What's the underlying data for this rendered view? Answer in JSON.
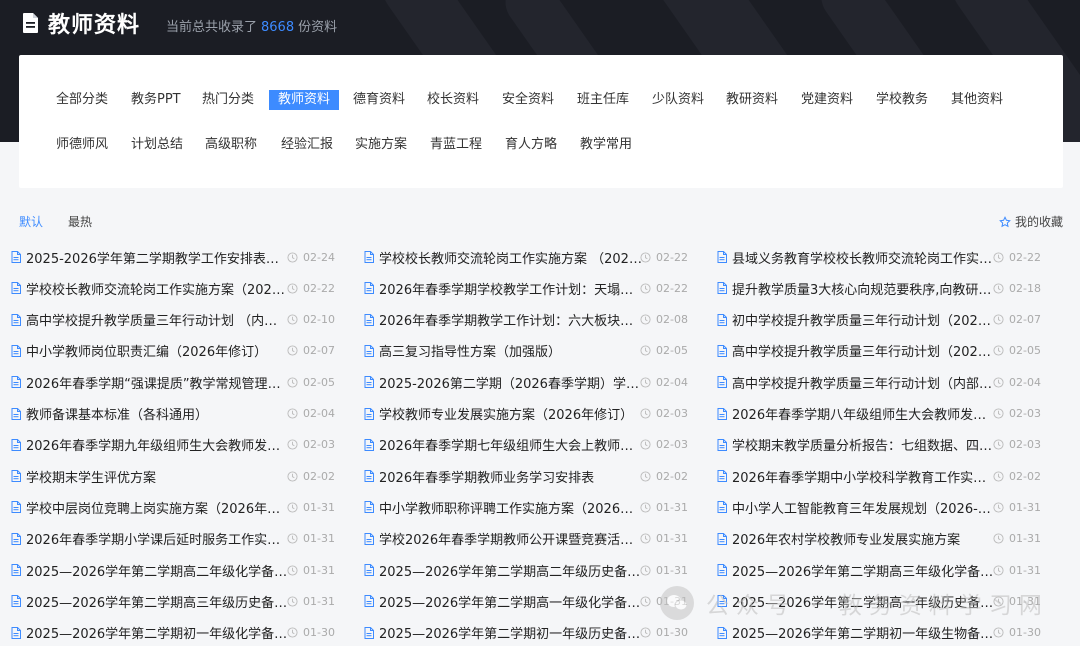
{
  "header": {
    "title": "教师资料",
    "count_prefix": "当前总共收录了",
    "count_value": "8668",
    "count_suffix": "份资料"
  },
  "categories": [
    {
      "label": "全部分类",
      "active": false
    },
    {
      "label": "教务PPT",
      "active": false
    },
    {
      "label": "热门分类",
      "active": false
    },
    {
      "label": "教师资料",
      "active": true
    },
    {
      "label": "德育资料",
      "active": false
    },
    {
      "label": "校长资料",
      "active": false
    },
    {
      "label": "安全资料",
      "active": false
    },
    {
      "label": "班主任库",
      "active": false
    },
    {
      "label": "少队资料",
      "active": false
    },
    {
      "label": "教研资料",
      "active": false
    },
    {
      "label": "党建资料",
      "active": false
    },
    {
      "label": "学校教务",
      "active": false
    },
    {
      "label": "其他资料",
      "active": false
    },
    {
      "label": "师德师风",
      "active": false
    },
    {
      "label": "计划总结",
      "active": false
    },
    {
      "label": "高级职称",
      "active": false
    },
    {
      "label": "经验汇报",
      "active": false
    },
    {
      "label": "实施方案",
      "active": false
    },
    {
      "label": "青蓝工程",
      "active": false
    },
    {
      "label": "育人方略",
      "active": false
    },
    {
      "label": "教学常用",
      "active": false
    }
  ],
  "sort": {
    "default_label": "默认",
    "hot_label": "最热",
    "favorites_label": "我的收藏"
  },
  "items": [
    {
      "title": "2025-2026学年第二学期教学工作安排表：龙…",
      "date": "02-24"
    },
    {
      "title": "学校校长教师交流轮岗工作实施方案 （2026…",
      "date": "02-22"
    },
    {
      "title": "县域义务教育学校校长教师交流轮岗工作实施…",
      "date": "02-22"
    },
    {
      "title": "学校校长教师交流轮岗工作实施方案（2026年…",
      "date": "02-22"
    },
    {
      "title": "2026年春季学期学校教学工作计划：天塌了！5…",
      "date": "02-22"
    },
    {
      "title": "提升教学质量3大核心向规范要秩序,向教研要…",
      "date": "02-18"
    },
    {
      "title": "高中学校提升教学质量三年行动计划 （内部使…",
      "date": "02-10"
    },
    {
      "title": "2026年春季学期教学工作计划：六大板块+落…",
      "date": "02-08"
    },
    {
      "title": "初中学校提升教学质量三年行动计划（2026-2…",
      "date": "02-07"
    },
    {
      "title": "中小学教师岗位职责汇编（2026年修订）",
      "date": "02-07"
    },
    {
      "title": "高三复习指导性方案（加强版）",
      "date": "02-05"
    },
    {
      "title": "高中学校提升教学质量三年行动计划（2026-2…",
      "date": "02-05"
    },
    {
      "title": "2026年春季学期“强课提质”教学常规管理实…",
      "date": "02-05"
    },
    {
      "title": "2025-2026第二学期（2026春季学期）学校教…",
      "date": "02-04"
    },
    {
      "title": "高中学校提升教学质量三年行动计划（内部使…",
      "date": "02-04"
    },
    {
      "title": "教师备课基本标准（各科通用）",
      "date": "02-04"
    },
    {
      "title": "学校教师专业发展实施方案（2026年修订）",
      "date": "02-03"
    },
    {
      "title": "2026年春季学期八年级组师生大会教师发言：…",
      "date": "02-03"
    },
    {
      "title": "2026年春季学期九年级组师生大会教师发言：…",
      "date": "02-03"
    },
    {
      "title": "2026年春季学期七年级组师生大会上教师发言…",
      "date": "02-03"
    },
    {
      "title": "学校期末教学质量分析报告：七组数据、四个…",
      "date": "02-03"
    },
    {
      "title": "学校期末学生评优方案",
      "date": "02-02"
    },
    {
      "title": "2026年春季学期教师业务学习安排表",
      "date": "02-02"
    },
    {
      "title": "2026年春季学期中小学校科学教育工作实施方…",
      "date": "02-02"
    },
    {
      "title": "学校中层岗位竞聘上岗实施方案（2026年修订…",
      "date": "01-31"
    },
    {
      "title": "中小学教师职称评聘工作实施方案（2026年修…",
      "date": "01-31"
    },
    {
      "title": "中小学人工智能教育三年发展规划（2026-202…",
      "date": "01-31"
    },
    {
      "title": "2026年春季学期小学课后延时服务工作实施方…",
      "date": "01-31"
    },
    {
      "title": "学校2026年春季学期教师公开课暨竞赛活动方…",
      "date": "01-31"
    },
    {
      "title": "2026年农村学校教师专业发展实施方案",
      "date": "01-31"
    },
    {
      "title": "2025—2026学年第二学期高二年级化学备课…",
      "date": "01-31"
    },
    {
      "title": "2025—2026学年第二学期高二年级历史备课…",
      "date": "01-31"
    },
    {
      "title": "2025—2026学年第二学期高三年级化学备课…",
      "date": "01-31"
    },
    {
      "title": "2025—2026学年第二学期高三年级历史备课…",
      "date": "01-31"
    },
    {
      "title": "2025—2026学年第二学期高一年级化学备课…",
      "date": "01-31"
    },
    {
      "title": "2025—2026学年第二学期高一年级历史备课…",
      "date": "01-31"
    },
    {
      "title": "2025—2026学年第二学期初一年级化学备课…",
      "date": "01-30"
    },
    {
      "title": "2025—2026学年第二学期初一年级历史备课…",
      "date": "01-30"
    },
    {
      "title": "2025—2026学年第二学期初一年级生物备课…",
      "date": "01-30"
    }
  ],
  "watermark": {
    "text": "公众号 · 教务资料学习网",
    "icon": "wechat-icon"
  },
  "colors": {
    "accent": "#3d8bff",
    "header_bg": "#1b1d24",
    "page_bg": "#f5f6f8"
  }
}
